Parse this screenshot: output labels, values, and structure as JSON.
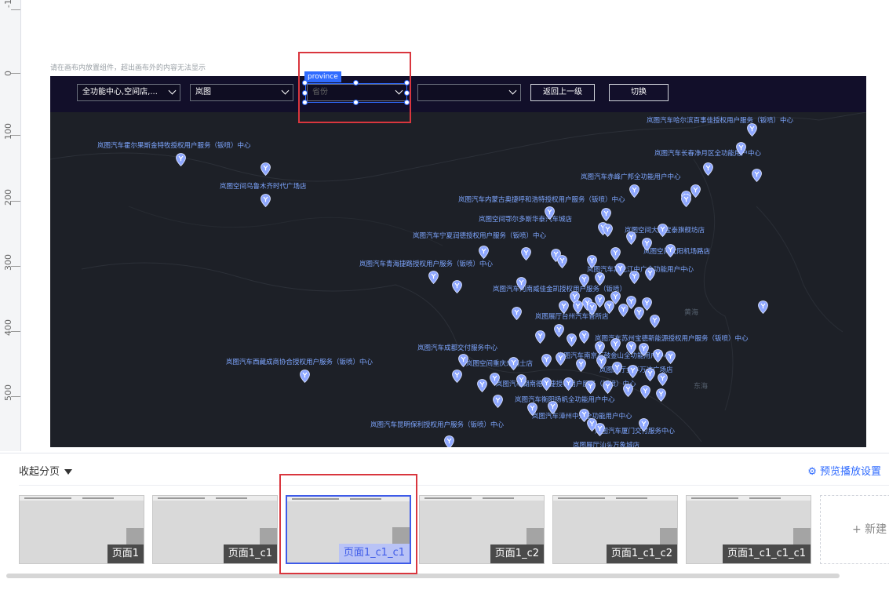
{
  "ruler": {
    "labels": [
      "-1",
      "0",
      "100",
      "200",
      "300",
      "400",
      "500"
    ]
  },
  "canvas_hint": "请在画布内放置组件，超出画布外的内容无法显示",
  "filters": {
    "select1": "全功能中心,空间店,...",
    "select2": "岚图",
    "select3_placeholder": "省份",
    "select4": "",
    "back_button": "返回上一级",
    "switch_button": "切换"
  },
  "selection": {
    "component_tag": "province"
  },
  "map": {
    "labels": [
      "岚图汽车哈尔滨百事佳授权用户服务（钣喷）中心",
      "岚图汽车霍尔果斯金特牧授权用户服务（钣喷）中心",
      "岚图汽车长春净月区全功能用户中心",
      "岚图空间乌鲁木齐时代广场店",
      "岚图汽车赤峰广邦全功能用户中心",
      "岚图汽车内蒙古奥捷呼和浩特授权用户服务（钣喷）中心",
      "岚图空间鄂尔多斯华泰汽车城店",
      "岚图汽车宁夏润德授权用户服务（钣喷）中心",
      "岚图空间大连宝泰旗舰坊店",
      "岚图空间沈阳机场路店",
      "岚图汽车青海捷路授权用户服务（钣喷）中心",
      "岚图汽车黑龙江中广全功能用户中心",
      "岚图汽车河南威佳金凯授权用户服务（钣喷）",
      "岚图展厅台州汽车管所店",
      "岚图汽车苏州宝德新能源授权用户服务（钣喷）中心",
      "岚图汽车成都交付服务中心",
      "岚图空间重庆来福士店",
      "岚图汽车西藏成商协合授权用户服务（钣喷）中心",
      "岚图汽车南京石鼓金山全功能用户中心",
      "岚图展厅金华万达广场店",
      "岚图汽车湖南德洲捷授权用户服务（钣喷）中心",
      "岚图汽车衡阳扬帆全功能用户中心",
      "岚图汽车漳州中升全功能用户中心",
      "岚图汽车昆明保利授权用户服务（钣喷）中心",
      "岚图汽车厦门交付服务中心",
      "岚图展厅汕头万象城店"
    ],
    "sea_labels": [
      "黄海",
      "东海"
    ]
  },
  "pages": {
    "collapse_label": "收起分页",
    "preview_settings": "预览播放设置",
    "thumbnails": [
      "页面1",
      "页面1_c1",
      "页面1_c1_c1",
      "页面1_c2",
      "页面1_c1_c2",
      "页面1_c1_c1_c1"
    ],
    "active_index": 2,
    "new_page": "+ 新建"
  },
  "colors": {
    "accent": "#2f6bff",
    "highlight": "#d9363e",
    "map_bg": "#1d2027",
    "pin": "#8fa8ff"
  }
}
